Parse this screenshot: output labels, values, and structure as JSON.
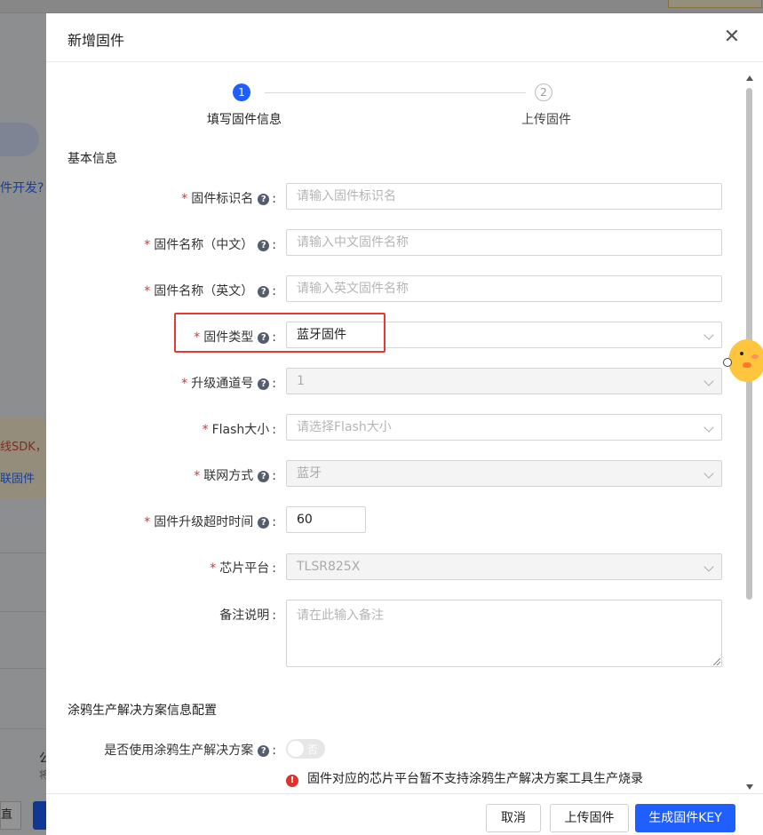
{
  "background": {
    "link_text": "件开发?",
    "notice_text": "线SDK，开",
    "notice_link": "联固件",
    "side_title": "公",
    "side_sub": "将",
    "left_button": "直"
  },
  "dialog": {
    "title": "新增固件",
    "close_icon": "close-icon",
    "steps": [
      {
        "number": "1",
        "label": "填写固件信息",
        "active": true
      },
      {
        "number": "2",
        "label": "上传固件",
        "active": false
      }
    ],
    "basic_section": "基本信息",
    "fields": {
      "firmware_key": {
        "label": "固件标识名",
        "placeholder": "请输入固件标识名"
      },
      "name_cn": {
        "label": "固件名称（中文）",
        "placeholder": "请输入中文固件名称"
      },
      "name_en": {
        "label": "固件名称（英文）",
        "placeholder": "请输入英文固件名称"
      },
      "firmware_type": {
        "label": "固件类型",
        "value": "蓝牙固件"
      },
      "upgrade_channel": {
        "label": "升级通道号",
        "value": "1"
      },
      "flash_size": {
        "label": "Flash大小",
        "placeholder": "请选择Flash大小"
      },
      "network_mode": {
        "label": "联网方式",
        "value": "蓝牙"
      },
      "timeout": {
        "label": "固件升级超时时间",
        "value": "60"
      },
      "chip_platform": {
        "label": "芯片平台",
        "value": "TLSR825X"
      },
      "remark": {
        "label": "备注说明",
        "placeholder": "请在此输入备注"
      }
    },
    "production_section": "涂鸦生产解决方案信息配置",
    "production_toggle": {
      "label": "是否使用涂鸦生产解决方案",
      "state": "否"
    },
    "warning_text": "固件对应的芯片平台暂不支持涂鸦生产解决方案工具生产烧录",
    "buttons": {
      "cancel": "取消",
      "upload": "上传固件",
      "generate": "生成固件KEY"
    },
    "colors": {
      "primary": "#1f5eff",
      "required": "#e0322b",
      "highlight_box": "#e53935"
    }
  }
}
